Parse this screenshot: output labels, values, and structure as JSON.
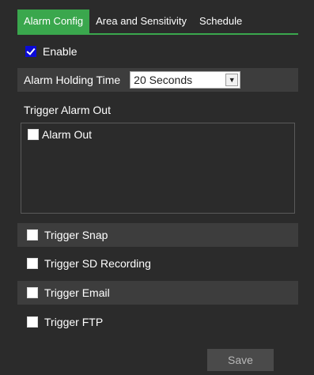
{
  "tabs": [
    {
      "label": "Alarm Config",
      "active": true
    },
    {
      "label": "Area and Sensitivity",
      "active": false
    },
    {
      "label": "Schedule",
      "active": false
    }
  ],
  "enable": {
    "label": "Enable",
    "checked": true
  },
  "holding_time": {
    "label": "Alarm Holding Time",
    "value": "20 Seconds"
  },
  "trigger_alarm_out": {
    "label": "Trigger Alarm Out",
    "items": [
      {
        "label": "Alarm Out",
        "checked": false
      }
    ]
  },
  "triggers": [
    {
      "label": "Trigger Snap",
      "checked": false
    },
    {
      "label": "Trigger SD Recording",
      "checked": false
    },
    {
      "label": "Trigger Email",
      "checked": false
    },
    {
      "label": "Trigger FTP",
      "checked": false
    }
  ],
  "save_label": "Save",
  "colors": {
    "accent": "#3aa74d",
    "checkbox_checked": "#0b0bd6",
    "background": "#2b2b2b",
    "stripe": "#3d3d3d"
  }
}
